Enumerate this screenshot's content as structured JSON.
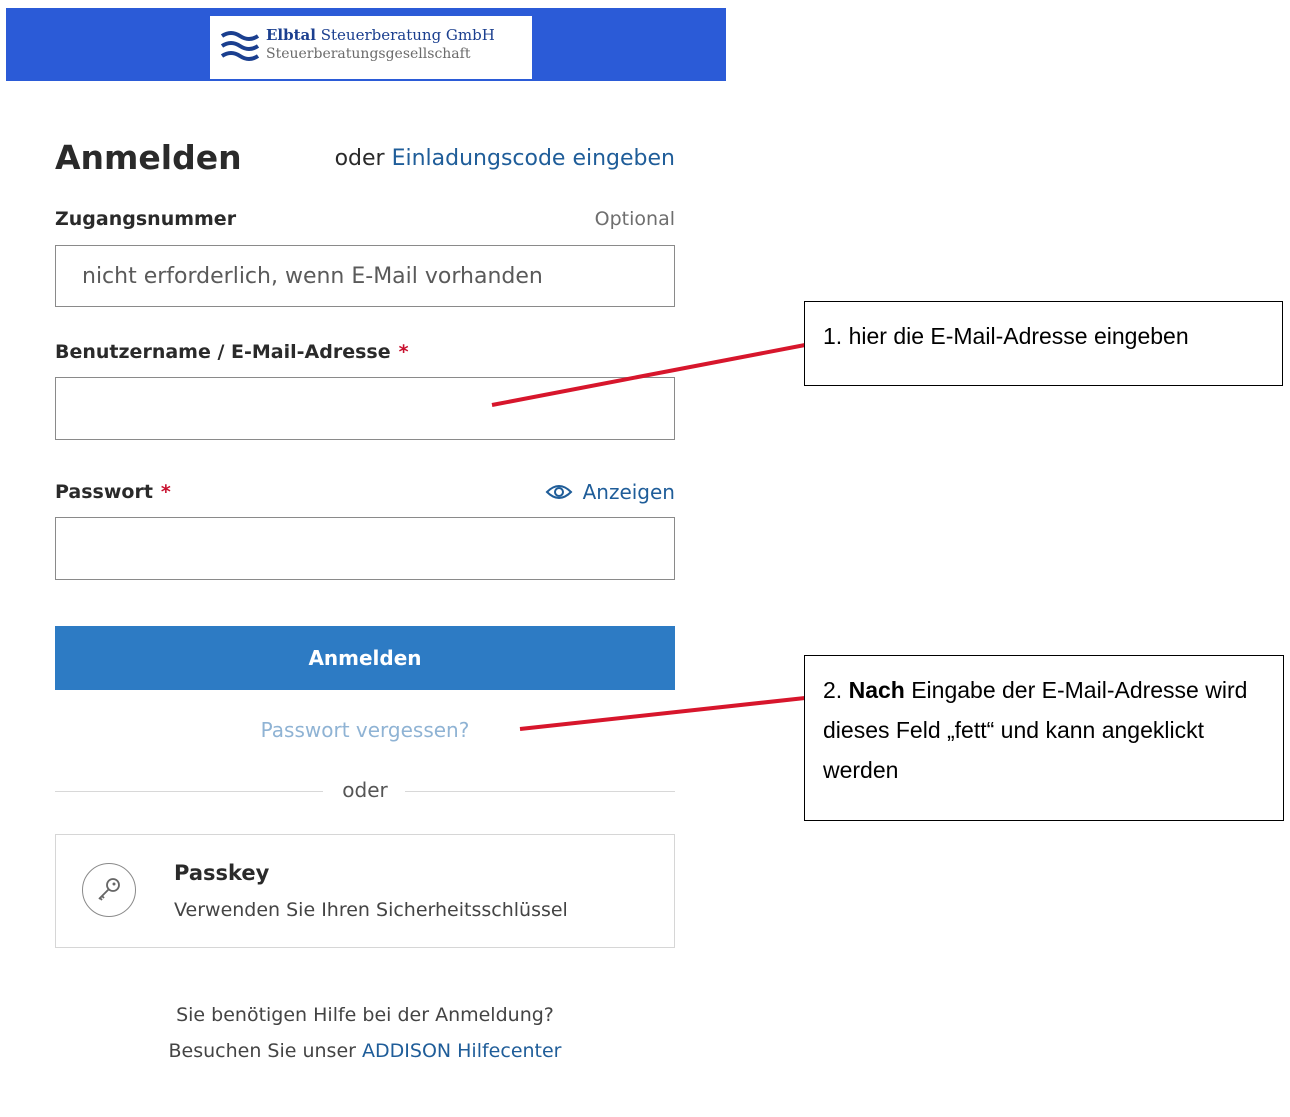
{
  "header": {
    "logo_name_bold": "Elbtal",
    "logo_name_rest": " Steuerberatung GmbH",
    "logo_sub": "Steuerberatungsgesellschaft",
    "logo_icon": "waves-icon",
    "bar_color": "#2b5bd7"
  },
  "login": {
    "title": "Anmelden",
    "invite_prefix": "oder ",
    "invite_link": "Einladungscode eingeben",
    "access_label": "Zugangsnummer",
    "access_optional": "Optional",
    "access_placeholder": "nicht erforderlich, wenn E-Mail vorhanden",
    "user_label": "Benutzername / E-Mail-Adresse",
    "required_mark": "*",
    "password_label": "Passwort",
    "show_label": "Anzeigen",
    "show_icon": "eye-icon",
    "submit_label": "Anmelden",
    "forgot_label": "Passwort vergessen?",
    "divider_text": "oder",
    "passkey_title": "Passkey",
    "passkey_sub": "Verwenden Sie Ihren Sicherheitsschlüssel",
    "passkey_icon": "key-icon",
    "help_line1": "Sie benötigen Hilfe bei der Anmeldung?",
    "help_prefix": "Besuchen Sie unser ",
    "help_link": "ADDISON Hilfecenter",
    "primary_color": "#2d7bc4",
    "link_color": "#1f5d99",
    "required_color": "#c8102e"
  },
  "annotations": {
    "callout1_text": "1. hier die E-Mail-Adresse eingeben",
    "callout2_num": "2. ",
    "callout2_bold": "Nach",
    "callout2_rest": " Eingabe der E-Mail-Adresse wird dieses Feld „fett“ und kann angeklickt werden",
    "arrow_color": "#d7162c"
  }
}
